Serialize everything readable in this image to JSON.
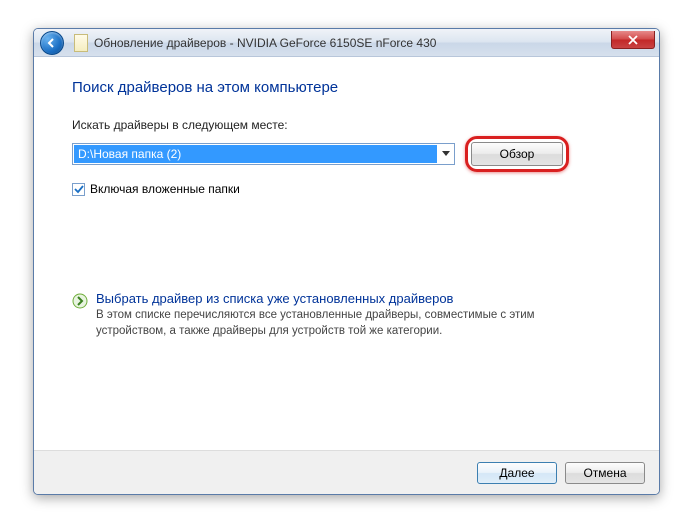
{
  "titlebar": {
    "title": "Обновление драйверов - NVIDIA GeForce 6150SE nForce 430"
  },
  "main": {
    "heading": "Поиск драйверов на этом компьютере",
    "search_label": "Искать драйверы в следующем месте:",
    "path_value": "D:\\Новая папка (2)",
    "browse_label": "Обзор",
    "include_subfolders_label": "Включая вложенные папки",
    "link": {
      "title": "Выбрать драйвер из списка уже установленных драйверов",
      "desc": "В этом списке перечисляются все установленные драйверы, совместимые с этим устройством, а также драйверы для устройств той же категории."
    }
  },
  "footer": {
    "next_label": "Далее",
    "cancel_label": "Отмена"
  }
}
